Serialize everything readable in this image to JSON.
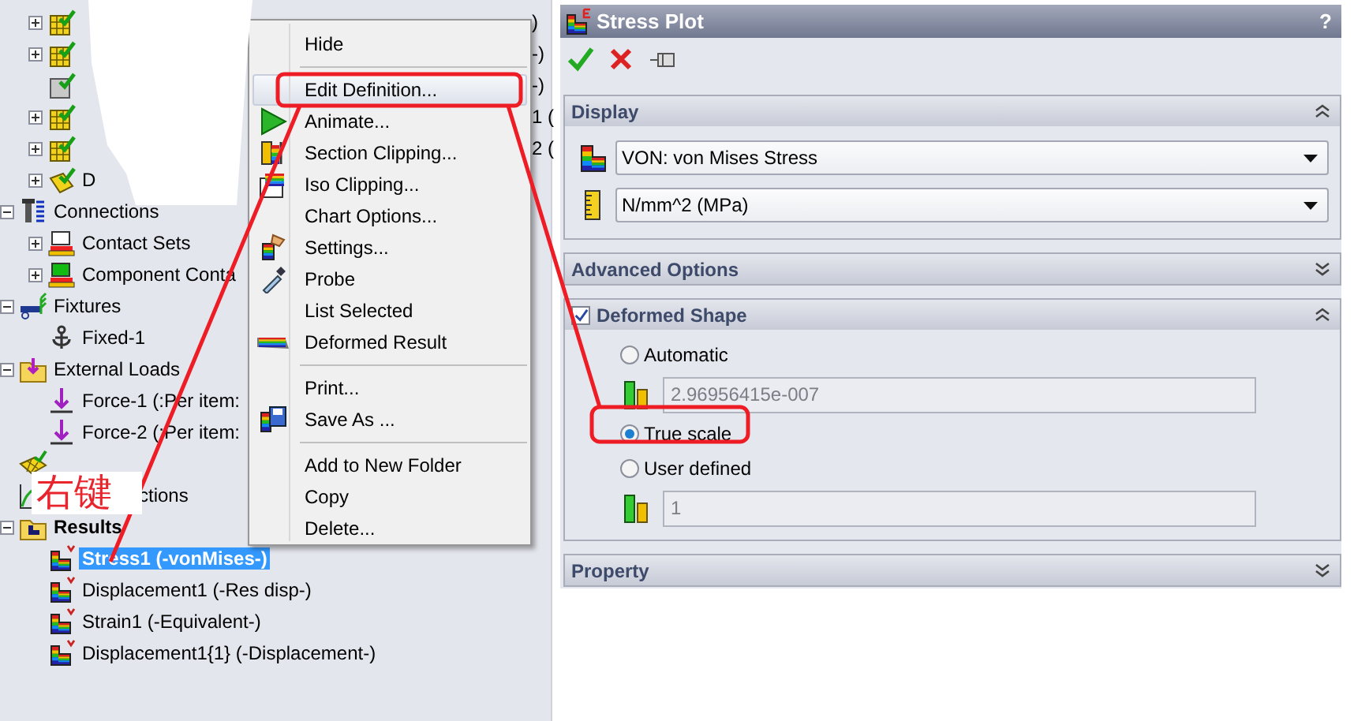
{
  "tree": [
    {
      "kind": "parts-folder",
      "children": [
        {
          "kind": "part",
          "expanded": false,
          "tail": ")"
        },
        {
          "kind": "part",
          "expanded": false,
          "tail": "-)"
        },
        {
          "kind": "part-plain",
          "tail": "-)"
        },
        {
          "kind": "part",
          "expanded": false,
          "tail": "1 ("
        },
        {
          "kind": "part",
          "expanded": false,
          "tail": "2 ("
        },
        {
          "kind": "part-alt",
          "expanded": false,
          "label": "D"
        }
      ]
    },
    {
      "kind": "connections",
      "label": "Connections",
      "expanded": true,
      "children": [
        {
          "kind": "contact",
          "label": "Contact Sets",
          "expanded": false
        },
        {
          "kind": "contact-alt",
          "label": "Component Conta",
          "expanded": false
        }
      ]
    },
    {
      "kind": "fixtures",
      "label": "Fixtures",
      "expanded": true,
      "children": [
        {
          "kind": "fixed",
          "label": "Fixed-1"
        }
      ]
    },
    {
      "kind": "loads",
      "label": "External Loads",
      "expanded": true,
      "children": [
        {
          "kind": "force",
          "label": "Force-1 (:Per item:"
        },
        {
          "kind": "force",
          "label": "Force-2 (:Per item:"
        }
      ]
    },
    {
      "kind": "mesh"
    },
    {
      "kind": "options",
      "label": "ctions"
    },
    {
      "kind": "results",
      "label": "Results",
      "expanded": true,
      "children": [
        {
          "kind": "plot",
          "label": "Stress1 (-vonMises-)",
          "selected": true
        },
        {
          "kind": "plot",
          "label": "Displacement1 (-Res disp-)",
          "selected": false
        },
        {
          "kind": "plot",
          "label": "Strain1 (-Equivalent-)",
          "selected": false
        },
        {
          "kind": "plot",
          "label": "Displacement1{1} (-Displacement-)",
          "selected": false
        }
      ]
    }
  ],
  "context_menu": [
    {
      "kind": "plain",
      "label": "Hide",
      "highlighted": false
    },
    {
      "kind": "separator"
    },
    {
      "kind": "plain",
      "label": "Edit Definition...",
      "highlighted": true
    },
    {
      "kind": "play",
      "label": "Animate...",
      "highlighted": false
    },
    {
      "kind": "section",
      "label": "Section Clipping...",
      "highlighted": false
    },
    {
      "kind": "iso",
      "label": "Iso Clipping...",
      "highlighted": false
    },
    {
      "kind": "plain",
      "label": "Chart Options...",
      "highlighted": false
    },
    {
      "kind": "settings",
      "label": "Settings...",
      "highlighted": false
    },
    {
      "kind": "probe",
      "label": "Probe",
      "highlighted": false
    },
    {
      "kind": "plain",
      "label": "List Selected",
      "highlighted": false
    },
    {
      "kind": "deformed",
      "label": "Deformed Result",
      "highlighted": false
    },
    {
      "kind": "separator"
    },
    {
      "kind": "plain",
      "label": "Print...",
      "highlighted": false
    },
    {
      "kind": "save",
      "label": "Save As ...",
      "highlighted": false
    },
    {
      "kind": "separator"
    },
    {
      "kind": "plain",
      "label": "Add to New Folder",
      "highlighted": false
    },
    {
      "kind": "plain",
      "label": "Copy",
      "highlighted": false
    },
    {
      "kind": "plain",
      "label": "Delete...",
      "highlighted": false
    }
  ],
  "property_manager": {
    "title": "Stress Plot",
    "help": "?",
    "groups": [
      {
        "kind": "display",
        "title": "Display",
        "collapsed": false,
        "selects": [
          {
            "kind": "contour",
            "value": "VON: von Mises Stress"
          },
          {
            "kind": "ruler",
            "value": "N/mm^2 (MPa)"
          }
        ]
      },
      {
        "title": "Advanced Options",
        "collapsed": true
      },
      {
        "kind": "deformed",
        "title": "Deformed Shape",
        "checked": true,
        "collapsed": false,
        "options": [
          {
            "label": "Automatic",
            "selected": false,
            "field": {
              "value": "2.96956415e-007",
              "disabled": true
            }
          },
          {
            "label": "True scale",
            "selected": true
          },
          {
            "label": "User defined",
            "selected": false,
            "field": {
              "value": "1",
              "disabled": true
            }
          }
        ]
      },
      {
        "title": "Property",
        "collapsed": true
      }
    ]
  },
  "annotation": {
    "callout": "右键"
  }
}
